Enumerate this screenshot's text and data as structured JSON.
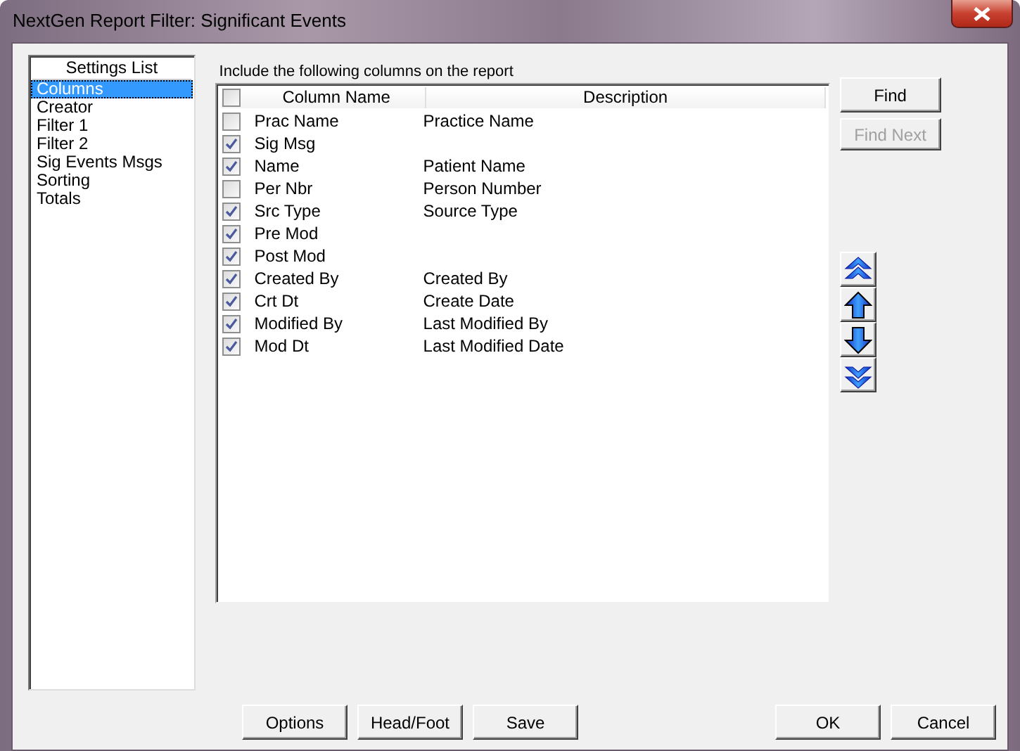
{
  "window": {
    "title": "NextGen Report Filter: Significant Events"
  },
  "settings_list": {
    "header": "Settings List",
    "items": [
      {
        "label": "Columns",
        "selected": true
      },
      {
        "label": "Creator",
        "selected": false
      },
      {
        "label": "Filter 1",
        "selected": false
      },
      {
        "label": "Filter 2",
        "selected": false
      },
      {
        "label": "Sig Events Msgs",
        "selected": false
      },
      {
        "label": "Sorting",
        "selected": false
      },
      {
        "label": "Totals",
        "selected": false
      }
    ]
  },
  "columns_label": "Include the following columns on the report",
  "table": {
    "select_all_checked": false,
    "columns": [
      "Column Name",
      "Description"
    ],
    "rows": [
      {
        "name": "Prac Name",
        "description": "Practice Name",
        "checked": false
      },
      {
        "name": "Sig Msg",
        "checked": true
      },
      {
        "name": "Name",
        "description": "Patient Name",
        "checked": true
      },
      {
        "name": "Per Nbr",
        "description": "Person Number",
        "checked": false
      },
      {
        "name": "Src Type",
        "description": "Source Type",
        "checked": true
      },
      {
        "name": "Pre Mod",
        "checked": true
      },
      {
        "name": "Post Mod",
        "checked": true
      },
      {
        "name": "Created By",
        "description": "Created By",
        "checked": true
      },
      {
        "name": "Crt Dt",
        "description": "Create Date",
        "checked": true
      },
      {
        "name": "Modified By",
        "description": "Last Modified By",
        "checked": true
      },
      {
        "name": "Mod Dt",
        "description": "Last Modified Date",
        "checked": true
      }
    ]
  },
  "find_buttons": [
    {
      "label": "Find",
      "disabled": false
    },
    {
      "label": "Find Next",
      "disabled": true
    }
  ],
  "move_buttons": [
    {
      "kind": "top"
    },
    {
      "kind": "up"
    },
    {
      "kind": "down"
    },
    {
      "kind": "bottom"
    }
  ],
  "left_buttons": [
    "Options",
    "Head/Foot",
    "Save"
  ],
  "right_buttons": [
    "OK",
    "Cancel"
  ]
}
